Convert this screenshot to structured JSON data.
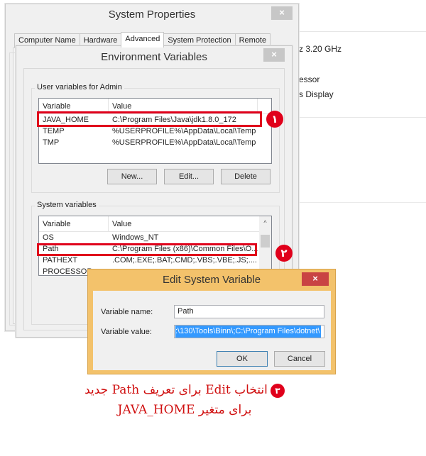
{
  "background_panel": {
    "lines": [
      "z  3.20 GHz",
      "essor",
      "s Display"
    ]
  },
  "system_properties": {
    "title": "System Properties",
    "close_glyph": "×",
    "tabs": [
      {
        "label": "Computer Name",
        "active": false
      },
      {
        "label": "Hardware",
        "active": false
      },
      {
        "label": "Advanced",
        "active": true
      },
      {
        "label": "System Protection",
        "active": false
      },
      {
        "label": "Remote",
        "active": false
      }
    ]
  },
  "environment_variables": {
    "title": "Environment Variables",
    "close_glyph": "×",
    "user_group": {
      "label": "User variables for Admin",
      "columns": [
        "Variable",
        "Value"
      ],
      "rows": [
        {
          "variable": "JAVA_HOME",
          "value": "C:\\Program Files\\Java\\jdk1.8.0_172"
        },
        {
          "variable": "TEMP",
          "value": "%USERPROFILE%\\AppData\\Local\\Temp"
        },
        {
          "variable": "TMP",
          "value": "%USERPROFILE%\\AppData\\Local\\Temp"
        }
      ],
      "buttons": {
        "new": "New...",
        "edit": "Edit...",
        "delete": "Delete"
      }
    },
    "system_group": {
      "label": "System variables",
      "columns": [
        "Variable",
        "Value"
      ],
      "rows": [
        {
          "variable": "OS",
          "value": "Windows_NT"
        },
        {
          "variable": "Path",
          "value": "C:\\Program Files (x86)\\Common Files\\O..."
        },
        {
          "variable": "PATHEXT",
          "value": ".COM;.EXE;.BAT;.CMD;.VBS;.VBE;.JS;...."
        },
        {
          "variable": "PROCESSOR_",
          "value": ""
        }
      ],
      "scroll_up_glyph": "^"
    }
  },
  "edit_dialog": {
    "title": "Edit System Variable",
    "close_glyph": "×",
    "name_label": "Variable name:",
    "name_value": "Path",
    "value_label": "Variable value:",
    "value_value": ":\\130\\Tools\\Binn\\;C:\\Program Files\\dotnet\\",
    "ok": "OK",
    "cancel": "Cancel"
  },
  "annotations": {
    "badge_1": "١",
    "badge_2": "٢",
    "badge_3": "٣",
    "highlight_color": "#e0001b",
    "caption_line1": "انتخاب Edit برای تعریف Path جدید",
    "caption_line2": "برای متغیر JAVA_HOME"
  }
}
